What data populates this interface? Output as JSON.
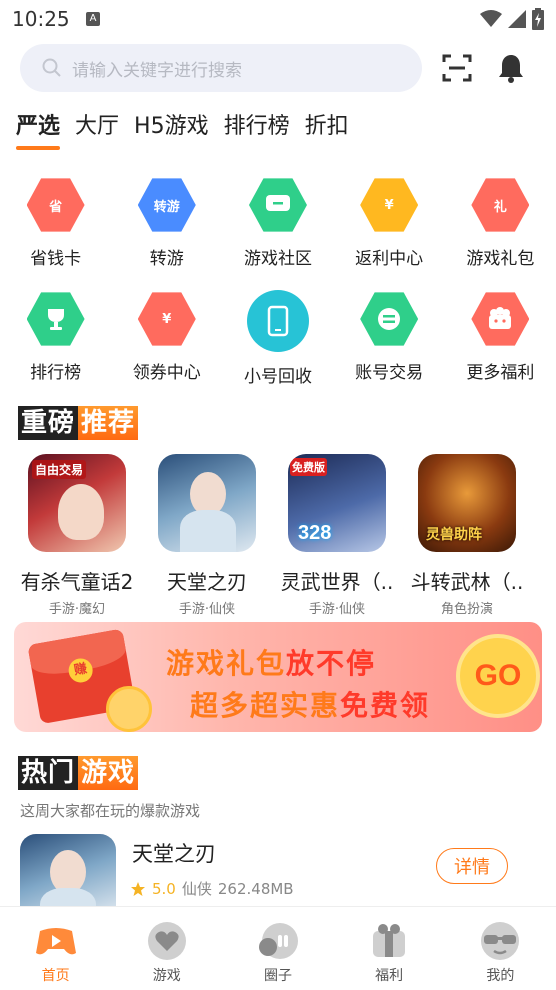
{
  "status_bar": {
    "time": "10:25",
    "notif_letter": "A"
  },
  "search": {
    "placeholder": "请输入关键字进行搜索"
  },
  "tabs": [
    {
      "label": "严选",
      "active": true
    },
    {
      "label": "大厅"
    },
    {
      "label": "H5游戏"
    },
    {
      "label": "排行榜"
    },
    {
      "label": "折扣"
    }
  ],
  "grid": {
    "row1": [
      {
        "label": "省钱卡",
        "icon_text": "省",
        "color": "#ff6b5e"
      },
      {
        "label": "转游",
        "icon_text": "转游",
        "color": "#4a8cff"
      },
      {
        "label": "游戏社区",
        "icon_text": "",
        "color": "#2fcf8a"
      },
      {
        "label": "返利中心",
        "icon_text": "¥",
        "color": "#ffb820"
      },
      {
        "label": "游戏礼包",
        "icon_text": "礼",
        "color": "#ff6b5e"
      }
    ],
    "row2": [
      {
        "label": "排行榜",
        "icon_text": "",
        "color": "#2fcf8a"
      },
      {
        "label": "领券中心",
        "icon_text": "¥",
        "color": "#ff6b5e"
      },
      {
        "label": "小号回收",
        "icon_text": "",
        "color": "#27c3d6"
      },
      {
        "label": "账号交易",
        "icon_text": "",
        "color": "#2fcf8a"
      },
      {
        "label": "更多福利",
        "icon_text": "",
        "color": "#ff6b5e"
      }
    ]
  },
  "featured": {
    "title_dark": "重磅",
    "title_orange": "推荐",
    "games": [
      {
        "name": "有杀气童话2",
        "tag": "手游·魔幻",
        "badge": "自由交易"
      },
      {
        "name": "天堂之刃",
        "tag": "手游·仙侠",
        "badge": ""
      },
      {
        "name": "灵武世界（..",
        "tag": "手游·仙侠",
        "badge": "免费版"
      },
      {
        "name": "斗转武林（..",
        "tag": "角色扮演",
        "badge": "灵兽助阵"
      }
    ]
  },
  "banner": {
    "line1_a": "游戏礼包",
    "line1_b": "放不停",
    "line2_a": "超多超实惠",
    "line2_b": "免费领",
    "go": "GO",
    "envelope_text": "赚"
  },
  "hot": {
    "title_dark": "热门",
    "title_orange": "游戏",
    "desc": "这周大家都在玩的爆款游戏",
    "game": {
      "name": "天堂之刃",
      "score": "5.0",
      "category": "仙侠",
      "size": "262.48MB",
      "button": "详情"
    }
  },
  "bottom_nav": [
    {
      "label": "首页",
      "active": true
    },
    {
      "label": "游戏"
    },
    {
      "label": "圈子"
    },
    {
      "label": "福利"
    },
    {
      "label": "我的"
    }
  ],
  "colors": {
    "accent": "#ff7a1a"
  }
}
